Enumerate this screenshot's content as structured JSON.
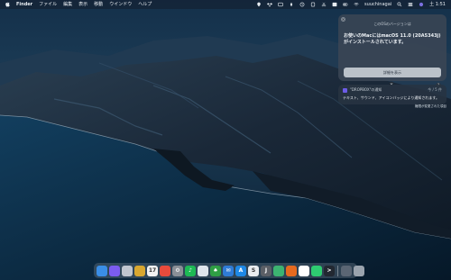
{
  "menubar": {
    "app_name": "Finder",
    "menus": [
      "ファイル",
      "編集",
      "表示",
      "移動",
      "ウインドウ",
      "ヘルプ"
    ],
    "user_name": "suuchinagai",
    "clock": "土 1:51"
  },
  "notification": {
    "title": "このOSのバージョンは",
    "body": "お使いのMacにはmacOS 11.0 (20A5343j) がインストールされています。",
    "button_label": "詳細を表示",
    "help_label": "?"
  },
  "notification2": {
    "app_label": "\"DROPBOX\"の通知",
    "more_label": "今 / 5 件",
    "text": "テキスト、サウンド、アイコンバッジにより通知されます。"
  },
  "notification2_footer": "権限が変更された項目",
  "colors": {
    "menubar": "#14202d",
    "panel": "#3a4654",
    "sea": "#0e2a44",
    "land": "#152233"
  },
  "dock": {
    "items": [
      {
        "name": "finder",
        "color": "#3a8ee6",
        "glyph": ""
      },
      {
        "name": "siri",
        "color": "#7b5cf0",
        "glyph": ""
      },
      {
        "name": "launchpad",
        "color": "#c0c6cf",
        "glyph": ""
      },
      {
        "name": "notes",
        "color": "#d8a730",
        "glyph": ""
      },
      {
        "name": "calendar",
        "color": "#f2f2f2",
        "glyph": "17"
      },
      {
        "name": "reminders",
        "color": "#e84b3c",
        "glyph": ""
      },
      {
        "name": "system-preferences",
        "color": "#8a8f96",
        "glyph": "⚙"
      },
      {
        "name": "spotify",
        "color": "#1db954",
        "glyph": "♪"
      },
      {
        "name": "preview",
        "color": "#dfe5ec",
        "glyph": ""
      },
      {
        "name": "feedly",
        "color": "#2f9e44",
        "glyph": "♠"
      },
      {
        "name": "mail",
        "color": "#2f7bd6",
        "glyph": "✉"
      },
      {
        "name": "app-store",
        "color": "#1e88e5",
        "glyph": "A"
      },
      {
        "name": "s-app",
        "color": "#e9ecef",
        "glyph": "S"
      },
      {
        "name": "j-app",
        "color": "#5b5f66",
        "glyph": "J"
      },
      {
        "name": "messages",
        "color": "#3cb371",
        "glyph": ""
      },
      {
        "name": "firefox",
        "color": "#e66a1f",
        "glyph": ""
      },
      {
        "name": "chrome",
        "color": "#ffffff",
        "glyph": ""
      },
      {
        "name": "photos",
        "color": "#2ecc71",
        "glyph": ""
      },
      {
        "name": "terminal",
        "color": "#222831",
        "glyph": ">"
      },
      {
        "name": "downloads",
        "color": "#5b6674",
        "glyph": ""
      },
      {
        "name": "trash",
        "color": "#9aa3ad",
        "glyph": ""
      }
    ]
  }
}
